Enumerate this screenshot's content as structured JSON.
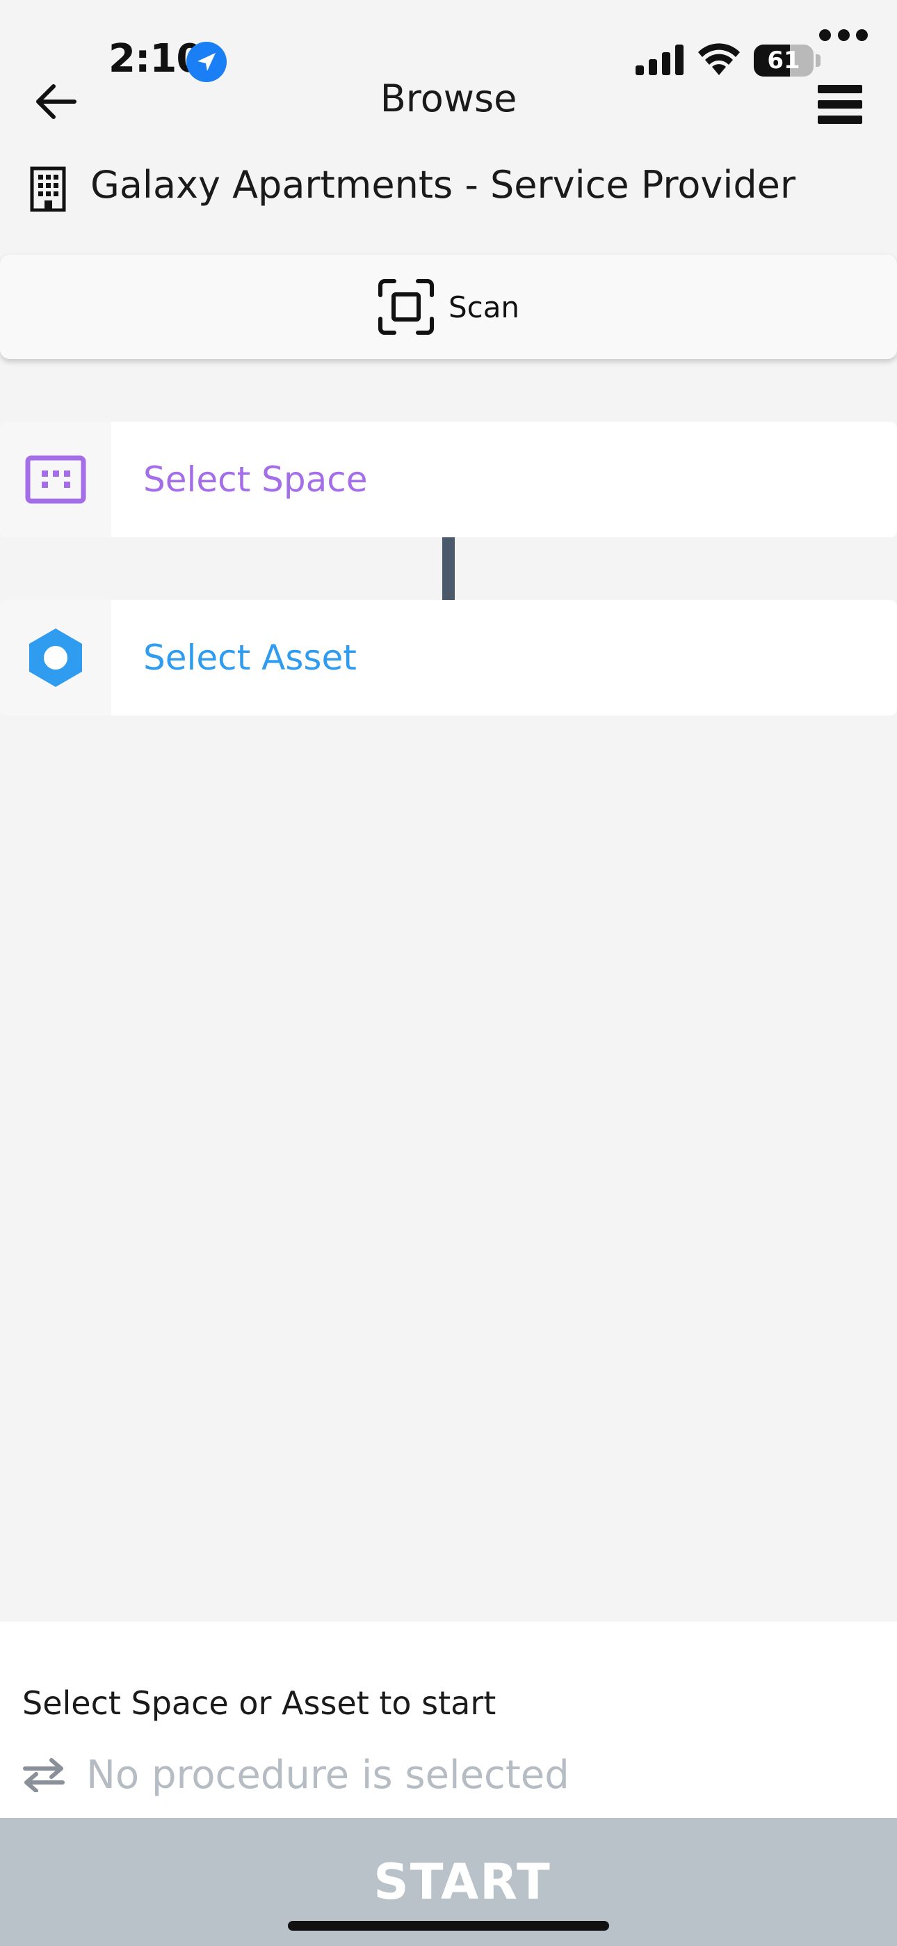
{
  "status_bar": {
    "time": "2:10",
    "battery_level": "61",
    "battery_fraction": 0.61,
    "icons": [
      "location-arrow-icon",
      "cellular-signal-icon",
      "wifi-icon",
      "battery-icon"
    ]
  },
  "header": {
    "title": "Browse",
    "back_icon": "arrow-left-icon",
    "menu_icon": "hamburger-menu-icon"
  },
  "site": {
    "name": "Galaxy Apartments - Service Provider",
    "icon": "building-icon",
    "more_icon": "more-horizontal-icon"
  },
  "scan": {
    "label": "Scan",
    "icon": "scan-frame-icon"
  },
  "selectors": {
    "space": {
      "label": "Select Space",
      "icon": "space-icon",
      "color": "#a46ee8"
    },
    "asset": {
      "label": "Select Asset",
      "icon": "hexagon-asset-icon",
      "color": "#2f9cf0"
    }
  },
  "bottom": {
    "hint": "Select Space or Asset to start",
    "procedure": "No procedure is selected",
    "procedure_icon": "swap-arrows-icon",
    "start_label": "START"
  },
  "colors": {
    "background": "#f4f4f4",
    "start_button": "#b8c2c8",
    "connector": "#4a5a6a",
    "location_blue": "#1a7ef5"
  }
}
